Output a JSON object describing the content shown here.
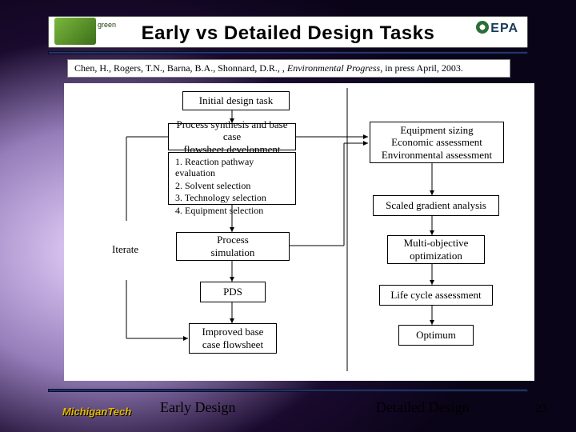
{
  "title": "Early vs Detailed Design Tasks",
  "citation": {
    "authors": "Chen, H., Rogers, T.N., Barna, B.A., Shonnard, D.R., , ",
    "journal": "Environmental Progress",
    "rest": ", in press April, 2003."
  },
  "nodes": {
    "initial": "Initial design task",
    "synth_l1": "Process synthesis and base case",
    "synth_l2": "flowsheet development",
    "list": {
      "i1": "1.  Reaction pathway evaluation",
      "i2": "2.  Solvent selection",
      "i3": "3.  Technology selection",
      "i4": "4.  Equipment selection"
    },
    "sim_l1": "Process",
    "sim_l2": "simulation",
    "pds": "PDS",
    "improved_l1": "Improved base",
    "improved_l2": "case flowsheet",
    "equip_l1": "Equipment sizing",
    "equip_l2": "Economic assessment",
    "equip_l3": "Environmental assessment",
    "scaled": "Scaled gradient analysis",
    "multi_l1": "Multi-objective",
    "multi_l2": "optimization",
    "lca": "Life cycle assessment",
    "optimum": "Optimum"
  },
  "iterate": "Iterate",
  "footer": {
    "left": "Early Design",
    "right": "Detailed Design",
    "page": "23",
    "mt": "MichiganTech"
  },
  "epa": "EPA"
}
